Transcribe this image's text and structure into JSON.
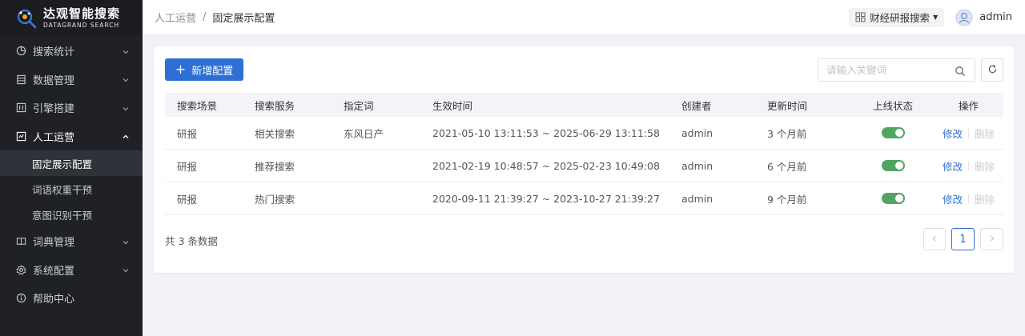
{
  "brand": {
    "title": "达观智能搜索",
    "subtitle": "DATAGRAND SEARCH"
  },
  "sidebar": {
    "items": [
      {
        "label": "搜索统计",
        "icon": "pie-chart-icon"
      },
      {
        "label": "数据管理",
        "icon": "database-icon"
      },
      {
        "label": "引擎搭建",
        "icon": "build-icon"
      },
      {
        "label": "人工运营",
        "icon": "operation-icon",
        "open": true,
        "children": [
          {
            "label": "固定展示配置",
            "active": true
          },
          {
            "label": "词语权重干预"
          },
          {
            "label": "意图识别干预"
          }
        ]
      },
      {
        "label": "词典管理",
        "icon": "book-icon"
      },
      {
        "label": "系统配置",
        "icon": "gear-icon"
      },
      {
        "label": "帮助中心",
        "icon": "info-icon"
      }
    ]
  },
  "header": {
    "breadcrumb": [
      "人工运营",
      "固定展示配置"
    ],
    "breadcrumb_sep": "/",
    "app_switch": "财经研报搜索",
    "username": "admin"
  },
  "toolbar": {
    "add_label": "新增配置",
    "search_placeholder": "请输入关键词"
  },
  "table": {
    "columns": [
      "搜索场景",
      "搜索服务",
      "指定词",
      "生效时间",
      "创建者",
      "更新时间",
      "上线状态",
      "操作"
    ],
    "rows": [
      {
        "scene": "研报",
        "service": "相关搜索",
        "word": "东风日产",
        "period": "2021-05-10 13:11:53 ~ 2025-06-29 13:11:58",
        "creator": "admin",
        "updated": "3 个月前",
        "online": true
      },
      {
        "scene": "研报",
        "service": "推荐搜索",
        "word": "",
        "period": "2021-02-19 10:48:57 ~ 2025-02-23 10:49:08",
        "creator": "admin",
        "updated": "6 个月前",
        "online": true
      },
      {
        "scene": "研报",
        "service": "热门搜索",
        "word": "",
        "period": "2020-09-11 21:39:27 ~ 2023-10-27 21:39:27",
        "creator": "admin",
        "updated": "9 个月前",
        "online": true
      }
    ],
    "edit_label": "修改",
    "delete_label": "删除"
  },
  "footer": {
    "total_text": "共 3 条数据",
    "current_page": "1"
  },
  "colors": {
    "primary": "#2e6fd6",
    "switch_on": "#52a463",
    "sidebar_bg": "#1f2126"
  }
}
